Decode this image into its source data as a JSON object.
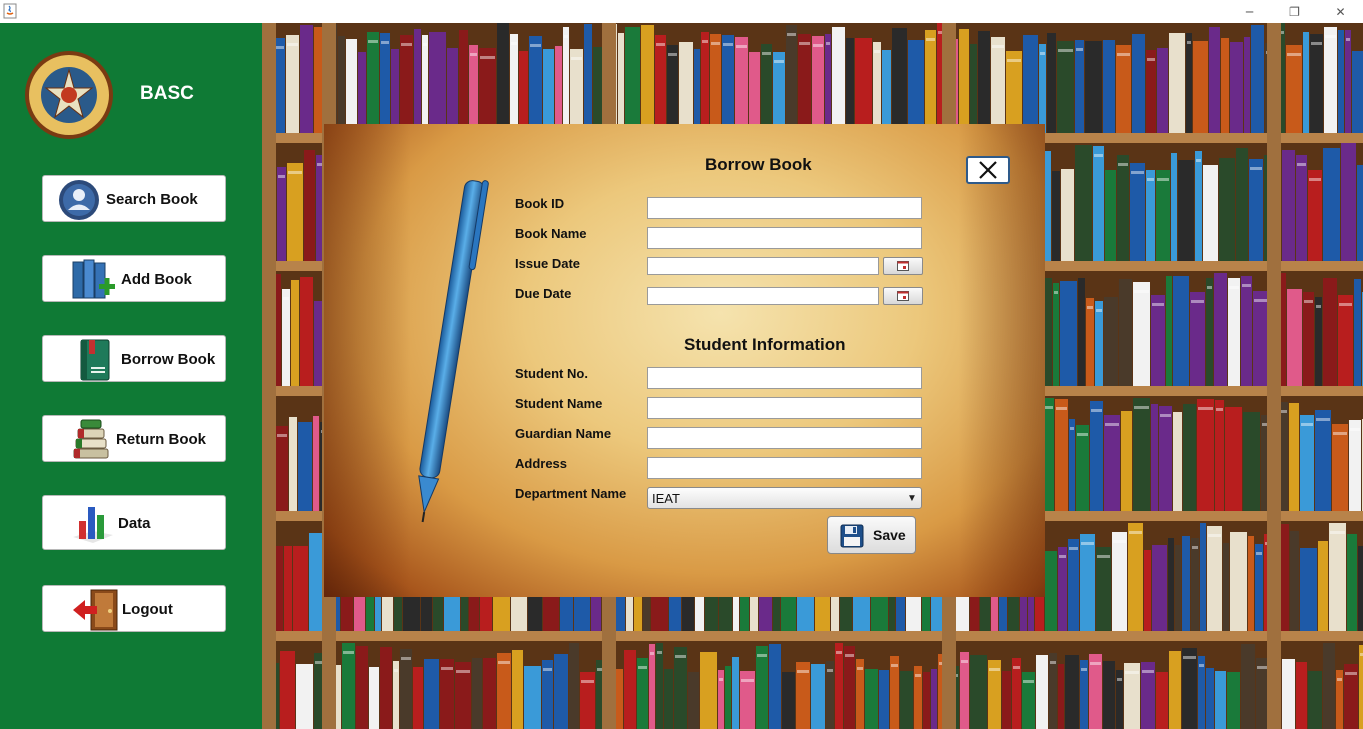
{
  "window": {
    "minimize": "─",
    "restore": "❐",
    "close": "✕"
  },
  "sidebar": {
    "app_name": "BASC",
    "logo": {
      "name": "basc-seal",
      "ring_text": "BULACAN AGRICULTURAL STATE COLLEGE",
      "year": "1952"
    },
    "items": [
      {
        "label": "Search Book",
        "icon": "user-icon"
      },
      {
        "label": "Add Book",
        "icon": "add-book-icon"
      },
      {
        "label": "Borrow Book",
        "icon": "book-icon"
      },
      {
        "label": "Return Book",
        "icon": "books-stack-icon"
      },
      {
        "label": "Data",
        "icon": "bar-chart-icon"
      },
      {
        "label": "Logout",
        "icon": "exit-door-icon"
      }
    ]
  },
  "dialog": {
    "title": "Borrow Book",
    "close_icon": "close-icon",
    "book_fields": [
      {
        "label": "Book ID",
        "value": ""
      },
      {
        "label": "Book Name",
        "value": ""
      },
      {
        "label": "Issue Date",
        "value": ""
      },
      {
        "label": "Due Date",
        "value": ""
      }
    ],
    "student_section_title": "Student Information",
    "student_fields": [
      {
        "label": "Student No.",
        "value": ""
      },
      {
        "label": "Student Name",
        "value": ""
      },
      {
        "label": "Guardian Name",
        "value": ""
      },
      {
        "label": "Address",
        "value": ""
      },
      {
        "label": "Department Name",
        "value": "IEAT"
      }
    ],
    "save_label": "Save"
  },
  "colors": {
    "sidebar": "#0f7a35",
    "dialog_parchment": "#ecc87c",
    "pen": "#2f7fc2"
  }
}
